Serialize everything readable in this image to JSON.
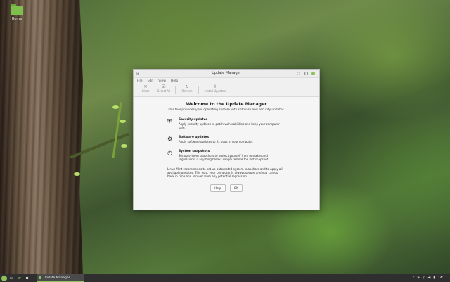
{
  "desktop": {
    "icon_label": "Home"
  },
  "window": {
    "title": "Update Manager",
    "menu": [
      "File",
      "Edit",
      "View",
      "Help"
    ],
    "toolbar": [
      {
        "icon": "clear-icon",
        "glyph": "✕",
        "label": "Clear"
      },
      {
        "icon": "select-all-icon",
        "glyph": "☑",
        "label": "Select All"
      },
      {
        "icon": "refresh-icon",
        "glyph": "↻",
        "label": "Refresh"
      },
      {
        "icon": "install-icon",
        "glyph": "⇩",
        "label": "Install Updates"
      }
    ],
    "heading": "Welcome to the Update Manager",
    "subtext": "This tool provides your operating system with software and security updates.",
    "features": [
      {
        "icon": "shield-icon",
        "glyph": "⛨",
        "title": "Security updates",
        "desc": "Apply security updates to patch vulnerabilities and keep your computer safe."
      },
      {
        "icon": "gear-icon",
        "glyph": "⚙",
        "title": "Software updates",
        "desc": "Apply software updates to fix bugs in your computer."
      },
      {
        "icon": "clock-icon",
        "glyph": "◷",
        "title": "System snapshots",
        "desc": "Set up system snapshots to protect yourself from mistakes and regressions, if anything breaks simply restore the last snapshot."
      }
    ],
    "note": "Linux Mint recommends to set up automated system snapshots and to apply all available updates. This way, your computer is always secure and you can go back in time and recover from any potential regression.",
    "buttons": {
      "help": "Help",
      "ok": "OK"
    }
  },
  "taskbar": {
    "task_label": "Update Manager",
    "clock": "14:11"
  }
}
